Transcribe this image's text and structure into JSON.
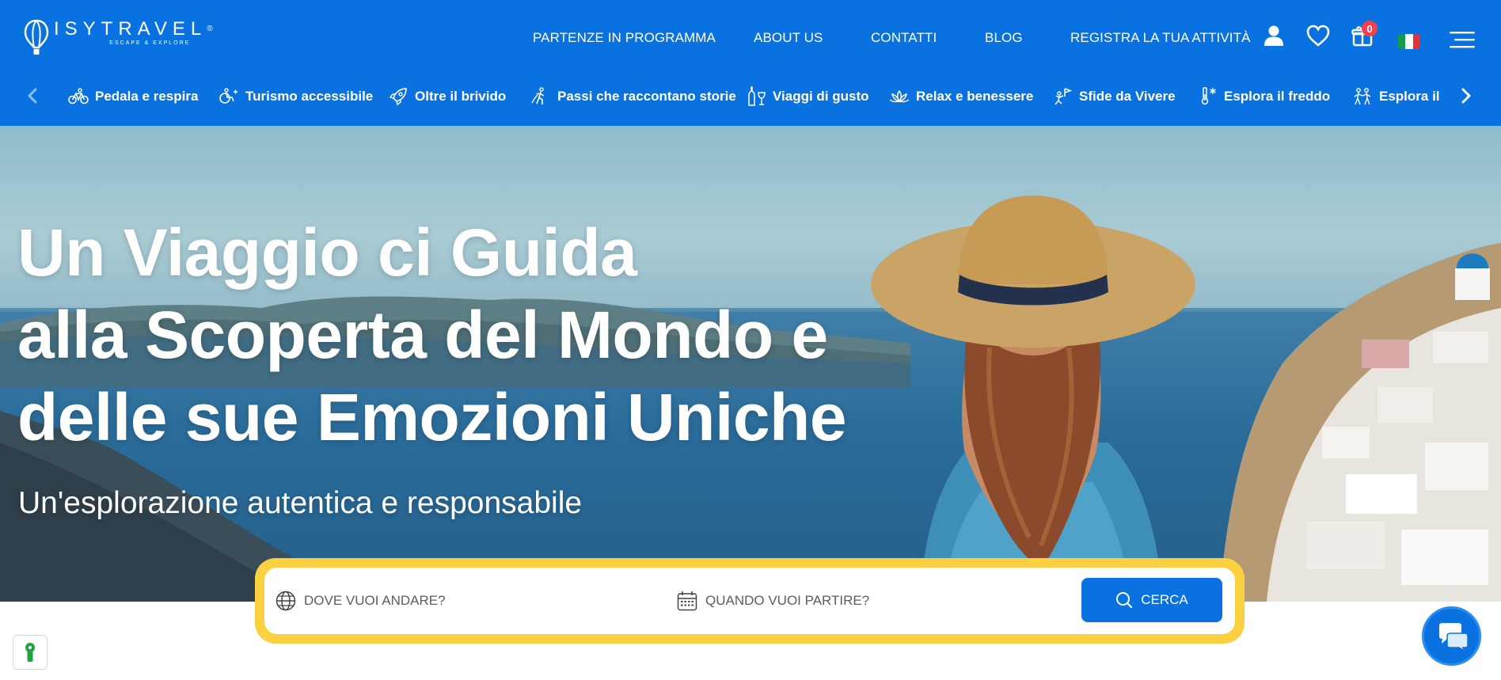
{
  "brand": {
    "name": "ISYTRAVEL",
    "registered": "®",
    "tagline": "ESCAPE & EXPLORE"
  },
  "nav": {
    "items": [
      {
        "label": "PARTENZE IN PROGRAMMA"
      },
      {
        "label": "ABOUT US"
      },
      {
        "label": "CONTATTI"
      },
      {
        "label": "BLOG"
      },
      {
        "label": "REGISTRA LA TUA ATTIVITÀ"
      }
    ],
    "cart_count": "0",
    "flag_colors": [
      "#159a48",
      "#ffffff",
      "#e2333a"
    ]
  },
  "categories": {
    "items": [
      {
        "label": "Pedala e respira",
        "icon": "bicycle-icon"
      },
      {
        "label": "Turismo accessibile",
        "icon": "accessibility-icon"
      },
      {
        "label": "Oltre il brivido",
        "icon": "rocket-icon"
      },
      {
        "label": "Passi che raccontano storie",
        "icon": "hiker-icon"
      },
      {
        "label": "Viaggi di gusto",
        "icon": "wine-icon"
      },
      {
        "label": "Relax e benessere",
        "icon": "lotus-icon"
      },
      {
        "label": "Sfide da Vivere",
        "icon": "flag-climb-icon"
      },
      {
        "label": "Esplora il freddo",
        "icon": "thermometer-snow-icon"
      },
      {
        "label": "Esplora il se",
        "icon": "people-icon"
      }
    ]
  },
  "hero": {
    "title_lines": [
      "Un Viaggio ci Guida",
      "alla Scoperta del Mondo e",
      "delle sue Emozioni Uniche"
    ],
    "subtitle": "Un'esplorazione autentica e responsabile"
  },
  "search": {
    "destination_placeholder": "DOVE VUOI ANDARE?",
    "date_placeholder": "QUANDO VUOI PARTIRE?",
    "button_label": "CERCA"
  },
  "colors": {
    "primary": "#0a72e0",
    "accent_yellow": "#fbd041",
    "badge_red": "#f2404c"
  }
}
